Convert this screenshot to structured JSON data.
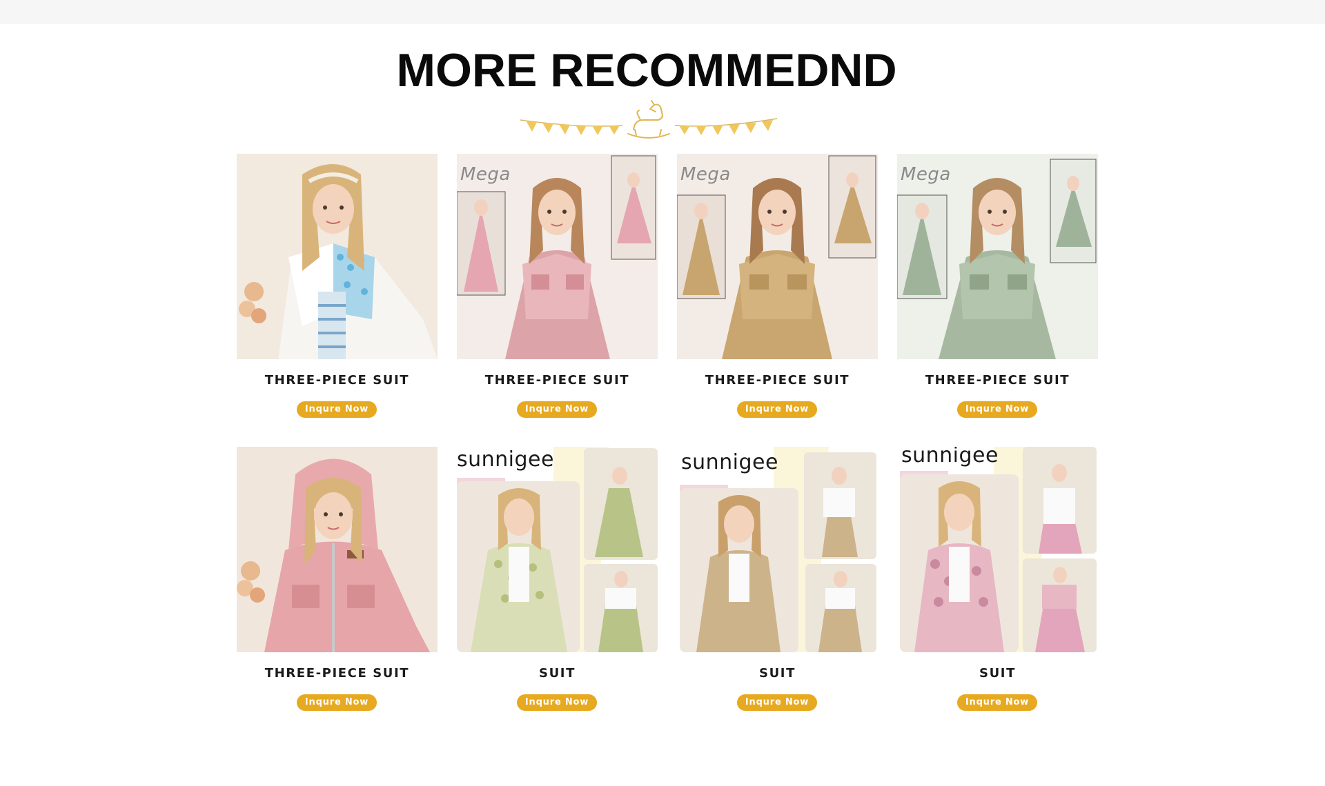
{
  "section": {
    "title": "MORE RECOMMEDND"
  },
  "colors": {
    "accent": "#e7a91f",
    "button_text": "#ffffff",
    "title": "#0a0a0a",
    "top_strip": "#f6f6f6"
  },
  "products": [
    {
      "title": "THREE-PIECE SUIT",
      "button": "Inqure Now",
      "image": "girl-white-patterned-jacket-photo"
    },
    {
      "title": "THREE-PIECE SUIT",
      "button": "Inqure Now",
      "image": "girl-pink-dress-jacket-photo"
    },
    {
      "title": "THREE-PIECE SUIT",
      "button": "Inqure Now",
      "image": "girl-khaki-dress-jacket-photo"
    },
    {
      "title": "THREE-PIECE SUIT",
      "button": "Inqure Now",
      "image": "girl-sage-dress-jacket-photo"
    },
    {
      "title": "THREE-PIECE SUIT",
      "button": "Inqure Now",
      "image": "girl-pink-hooded-jacket-photo"
    },
    {
      "title": "SUIT",
      "button": "Inqure Now",
      "image": "girl-green-print-suit-photo",
      "brand": "sunnigee"
    },
    {
      "title": "SUIT",
      "button": "Inqure Now",
      "image": "girl-khaki-suit-photo",
      "brand": "sunnigee"
    },
    {
      "title": "SUIT",
      "button": "Inqure Now",
      "image": "girl-pink-print-suit-photo",
      "brand": "sunnigee"
    }
  ]
}
